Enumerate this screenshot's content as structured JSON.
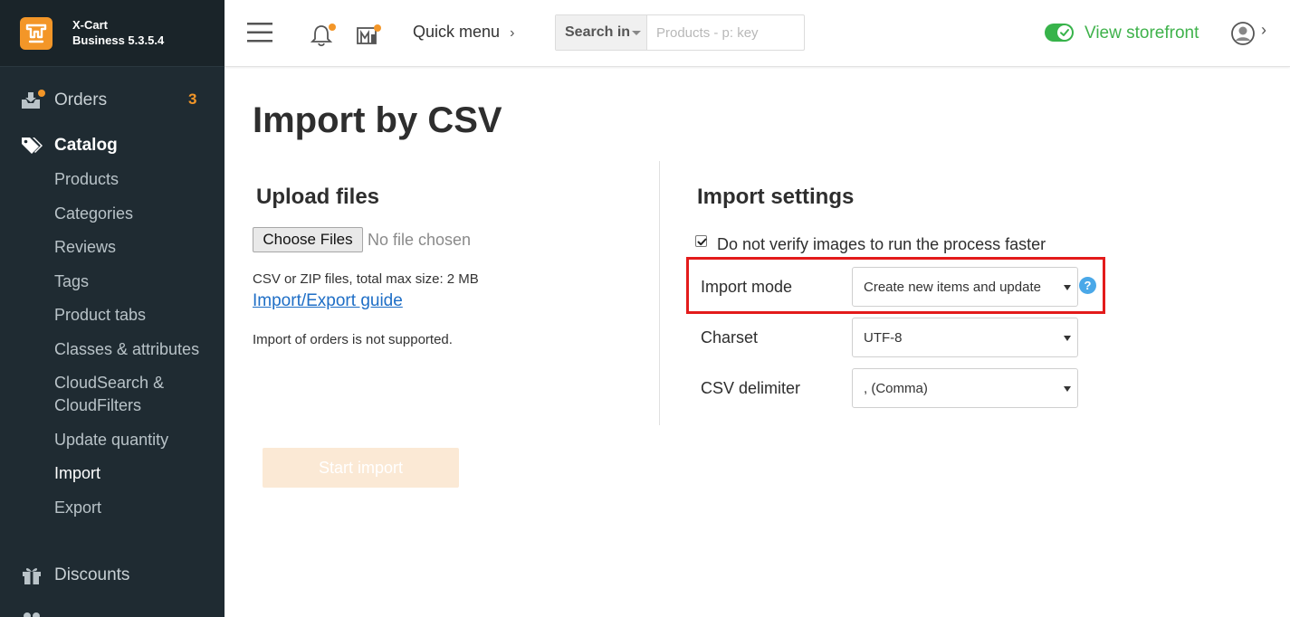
{
  "brand": {
    "name": "X-Cart",
    "version": "Business 5.3.5.4"
  },
  "sidebar": {
    "orders": {
      "label": "Orders",
      "count": "3"
    },
    "catalog": {
      "label": "Catalog",
      "items": [
        {
          "label": "Products"
        },
        {
          "label": "Categories"
        },
        {
          "label": "Reviews"
        },
        {
          "label": "Tags"
        },
        {
          "label": "Product tabs"
        },
        {
          "label": "Classes & attributes"
        },
        {
          "label": "CloudSearch & CloudFilters"
        },
        {
          "label": "Update quantity"
        },
        {
          "label": "Import",
          "active": true
        },
        {
          "label": "Export"
        }
      ]
    },
    "discounts": {
      "label": "Discounts"
    }
  },
  "header": {
    "quick_menu": "Quick menu",
    "search": {
      "scope": "Search in",
      "placeholder": "Products - p: key"
    },
    "storefront": "View storefront"
  },
  "page": {
    "title": "Import by CSV",
    "upload": {
      "title": "Upload files",
      "choose_button": "Choose Files",
      "no_file": "No file chosen",
      "help": "CSV or ZIP files, total max size: 2 MB",
      "guide_link": "Import/Export guide",
      "note": "Import of orders is not supported."
    },
    "settings": {
      "title": "Import settings",
      "verify_images_label": "Do not verify images to run the process faster",
      "verify_images_checked": true,
      "import_mode": {
        "label": "Import mode",
        "value": "Create new items and update"
      },
      "charset": {
        "label": "Charset",
        "value": "UTF-8"
      },
      "delimiter": {
        "label": "CSV delimiter",
        "value": ", (Comma)"
      },
      "help_glyph": "?"
    },
    "start_button": "Start import"
  },
  "colors": {
    "accent": "#f39628",
    "sidebar_bg": "#1f2b32",
    "storefront_green": "#3fb24b",
    "highlight_red": "#e31b1b",
    "link": "#1e6ec6"
  }
}
